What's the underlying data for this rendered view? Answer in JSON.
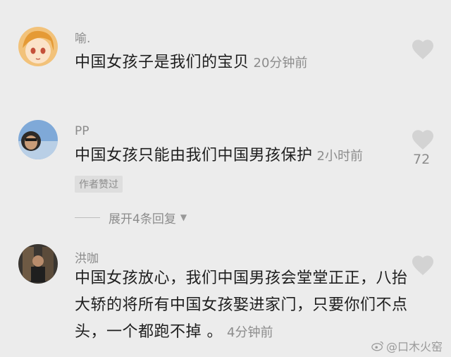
{
  "comments": [
    {
      "username": "喻.",
      "text_lines": [
        "中国女孩子是我们的宝贝"
      ],
      "time": "20分钟前",
      "like_count": "",
      "badge": ""
    },
    {
      "username": "PP",
      "text_lines": [
        "中国女孩只能由我们中国男孩保护"
      ],
      "time": "2小时前",
      "like_count": "72",
      "badge": "作者赞过"
    },
    {
      "username": "洪咖",
      "text_lines": [
        "中国女孩放心，我们中国男孩会堂堂正正，八抬",
        "大轿的将所有中国女孩娶进家门，只要你们不点",
        "头，一个都跑不掉 。"
      ],
      "time": "4分钟前",
      "like_count": "",
      "badge": ""
    }
  ],
  "expand_replies": "展开4条回复",
  "watermark": "@口木火窑",
  "icons": {
    "like": "heart-icon",
    "expand": "triangle-down-icon",
    "weibo": "weibo-logo-icon"
  },
  "colors": {
    "background": "#ececec",
    "heart": "#d3d3d3",
    "muted_text": "#8c8c8c"
  }
}
